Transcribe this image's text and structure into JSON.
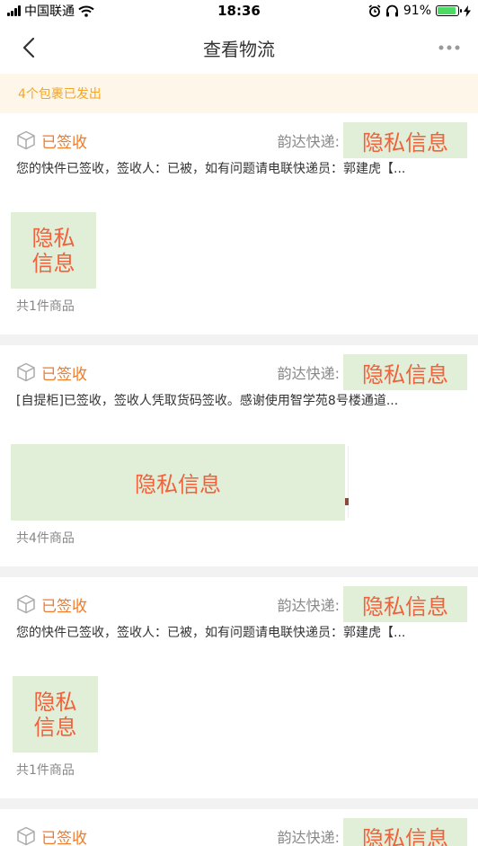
{
  "status_bar": {
    "carrier": "中国联通",
    "time": "18:36",
    "battery": "91%",
    "battery_level": 0.91
  },
  "nav": {
    "title": "查看物流"
  },
  "notice": {
    "text": "4个包裹已发出"
  },
  "packages": [
    {
      "status": "已签收",
      "courier": "韵达快递:",
      "tracking": "隐私信息",
      "description": "您的快件已签收，签收人：已被，如有问题请电联快递员：郭建虎【...",
      "image_text": "隐私信息",
      "count": "共1件商品"
    },
    {
      "status": "已签收",
      "courier": "韵达快递:",
      "tracking": "隐私信息",
      "description": "[自提柜]已签收，签收人凭取货码签收。感谢使用智学苑8号楼通道...",
      "image_text": "隐私信息",
      "count": "共4件商品"
    },
    {
      "status": "已签收",
      "courier": "韵达快递:",
      "tracking": "隐私信息",
      "description": "您的快件已签收，签收人：已被，如有问题请电联快递员：郭建虎【...",
      "image_text": "隐私信息",
      "count": "共1件商品"
    },
    {
      "status": "已签收",
      "courier": "韵达快递:",
      "tracking": "隐私信息"
    }
  ]
}
